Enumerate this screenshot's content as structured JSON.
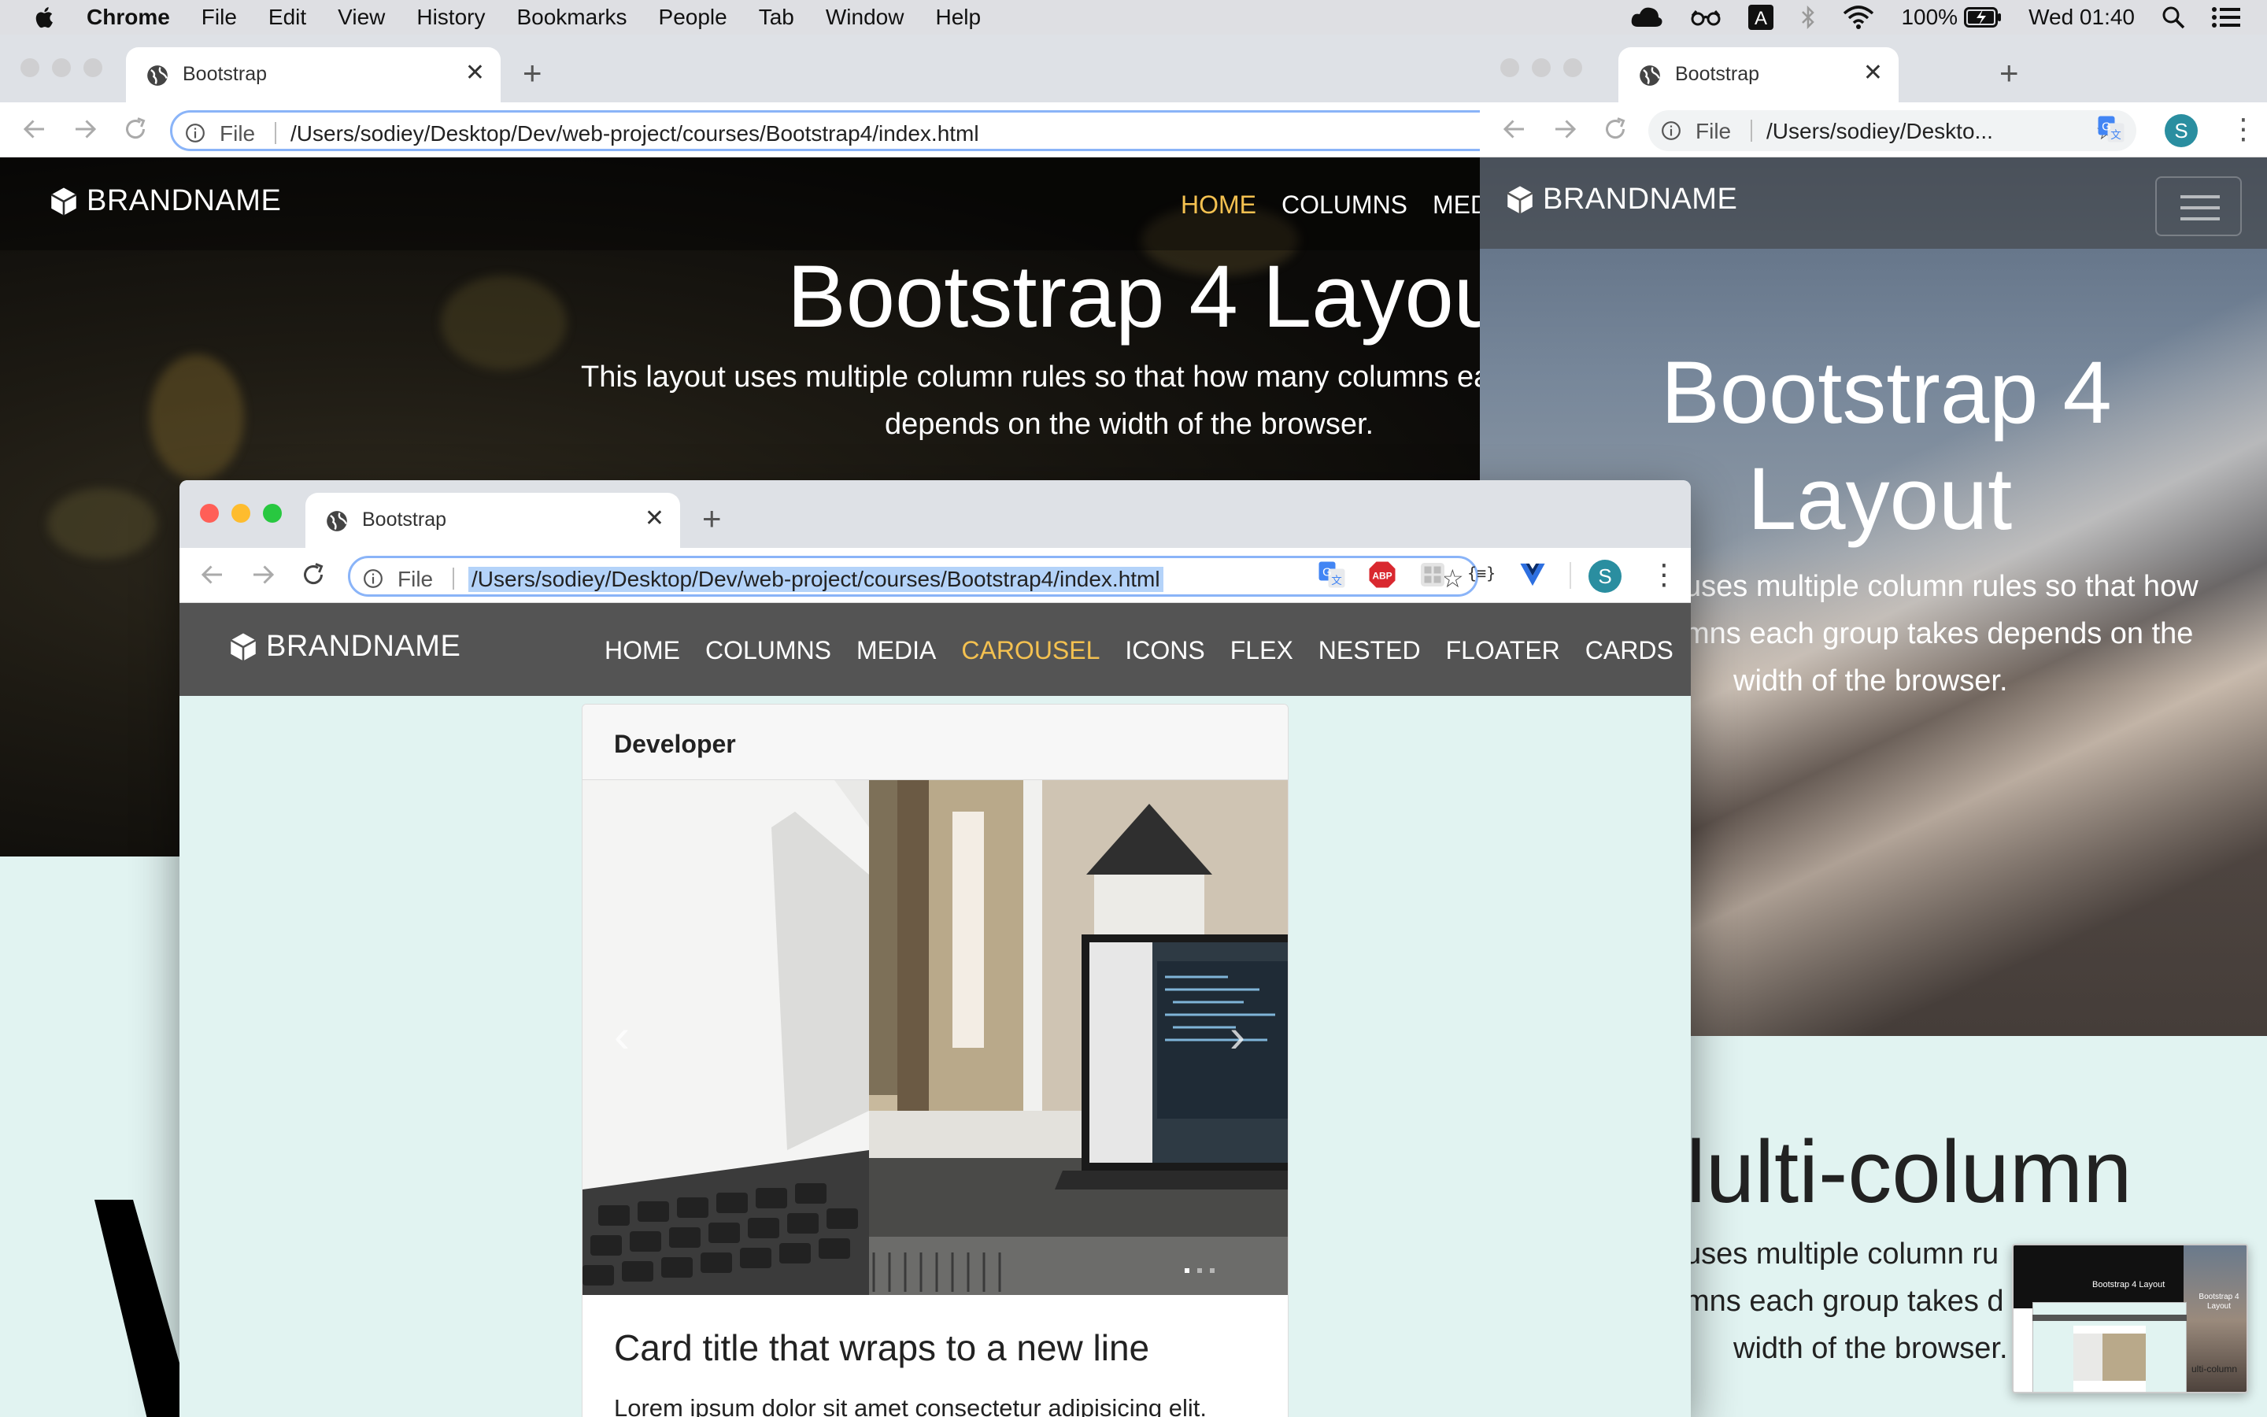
{
  "menubar": {
    "app": "Chrome",
    "items": [
      "File",
      "Edit",
      "View",
      "History",
      "Bookmarks",
      "People",
      "Tab",
      "Window",
      "Help"
    ],
    "battery": "100%",
    "clock": "Wed 01:40",
    "icons": [
      "apple-icon",
      "creative-cloud-icon",
      "glasses-icon",
      "input-a-icon",
      "bluetooth-icon",
      "wifi-icon",
      "battery-icon",
      "spotlight-search-icon",
      "control-center-icon"
    ]
  },
  "windows": {
    "back_left": {
      "tab_title": "Bootstrap",
      "url_label": "File",
      "url": "/Users/sodiey/Desktop/Dev/web-project/courses/Bootstrap4/index.html",
      "brand": "BRANDNAME",
      "nav": [
        "HOME",
        "COLUMNS",
        "MED"
      ],
      "active_nav": "HOME",
      "hero_title": "Bootstrap 4 Layout",
      "hero_line1": "This layout uses multiple column rules so that how many columns ea",
      "hero_line2": "depends on the width of the browser."
    },
    "back_right": {
      "tab_title": "Bootstrap",
      "url_label": "File",
      "url": "/Users/sodiey/Deskto...",
      "profile": "S",
      "brand": "BRANDNAME",
      "hero_title_1": "Bootstrap 4",
      "hero_title_2": "Layout",
      "hero_line1": "uses multiple column rules so that how",
      "hero_line2": "mns each group takes depends on the",
      "hero_line3": "width of the browser.",
      "section_title": "lulti-column",
      "section_line1": "uses multiple column ru",
      "section_line2": "mns each group takes d",
      "section_line3": "width of the browser."
    },
    "front": {
      "tab_title": "Bootstrap",
      "url_label": "File",
      "url": "/Users/sodiey/Desktop/Dev/web-project/courses/Bootstrap4/index.html",
      "profile": "S",
      "extensions": [
        "translate-icon",
        "adblock-plus-icon",
        "extension-grid-icon",
        "json-formatter-icon",
        "vue-devtools-icon"
      ],
      "abp_label": "ABP",
      "json_label": "{≡}",
      "brand": "BRANDNAME",
      "nav": [
        "HOME",
        "COLUMNS",
        "MEDIA",
        "CAROUSEL",
        "ICONS",
        "FLEX",
        "NESTED",
        "FLOATER",
        "CARDS"
      ],
      "active_nav": "CAROUSEL",
      "card": {
        "header": "Developer",
        "title": "Card title that wraps to a new line",
        "text": "Lorem ipsum dolor sit amet consectetur adipisicing elit."
      }
    }
  },
  "thumbnail": {
    "title": "Bootstrap 4 Layout",
    "side_title": "Bootstrap 4 Layout",
    "side_text": "ulti-column"
  },
  "colors": {
    "accent_nav": "#f4c150",
    "page_bg": "#e1f3f1",
    "navbar_front": "#545454",
    "profile_avatar": "#2a8ea0"
  }
}
